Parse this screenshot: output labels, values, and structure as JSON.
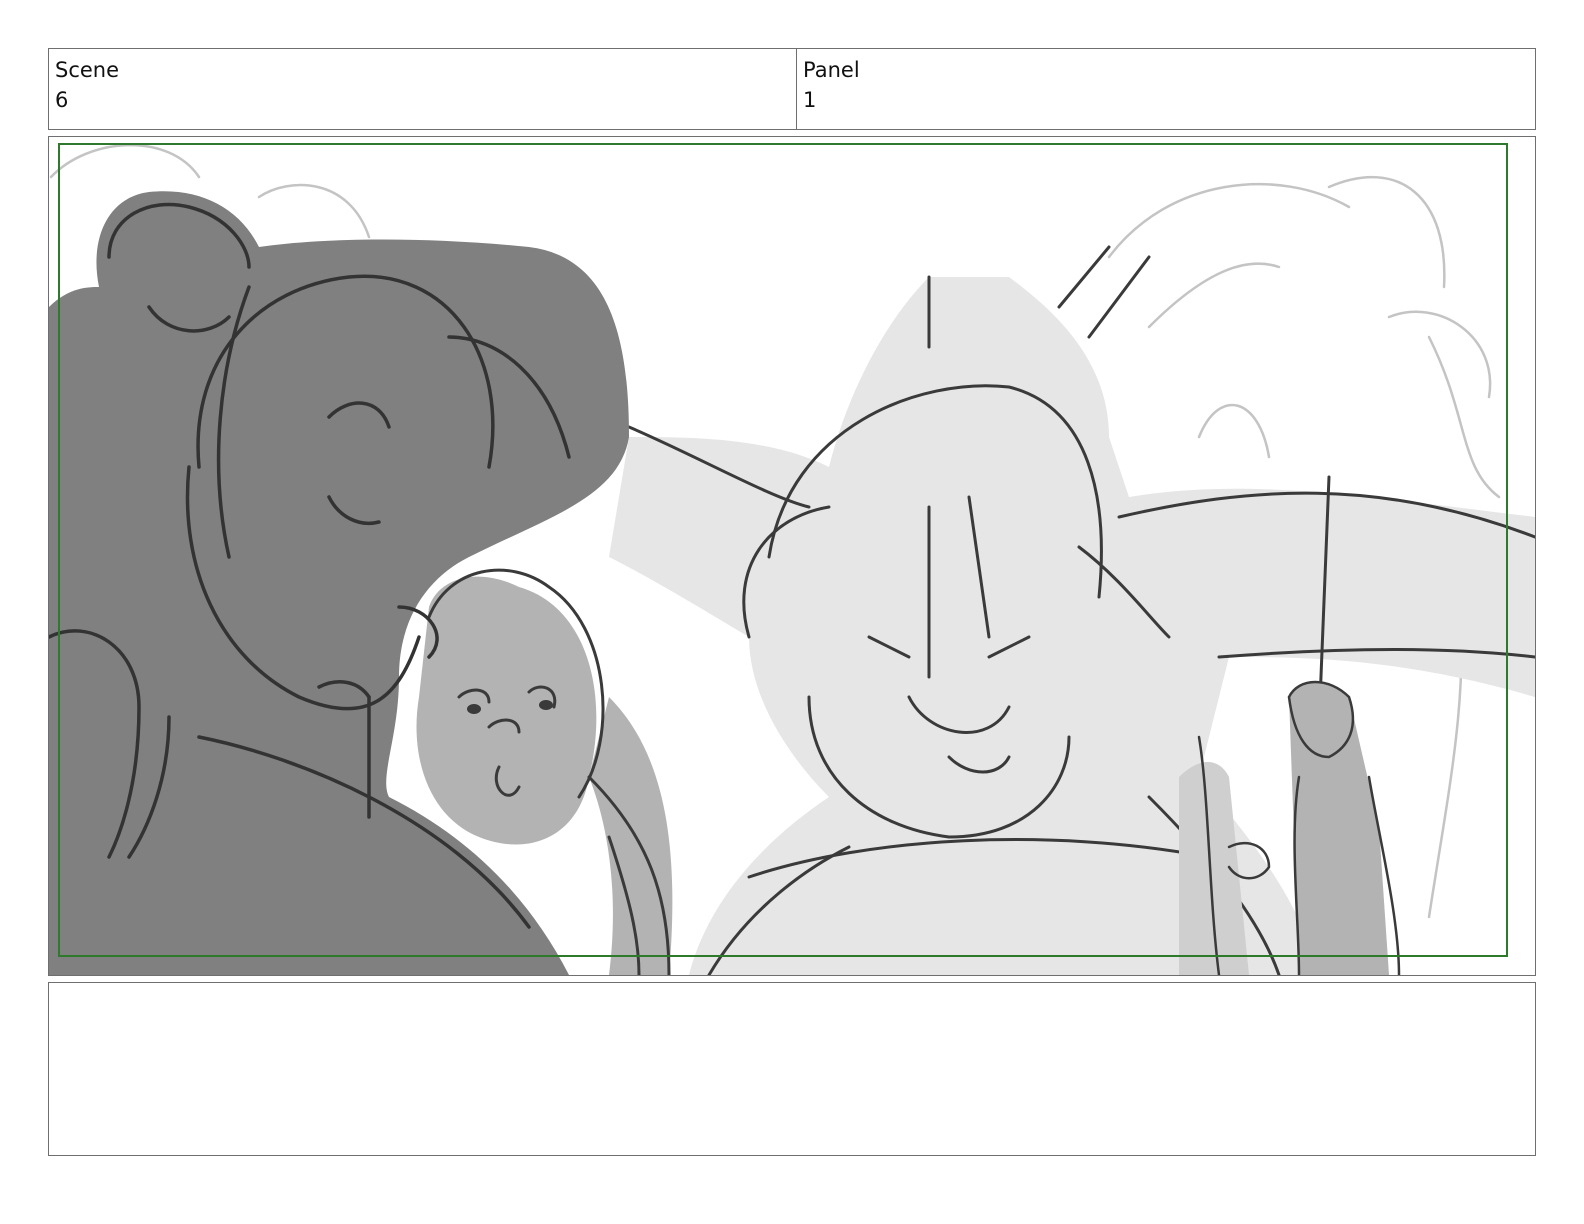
{
  "header": {
    "scene_label": "Scene",
    "scene_value": "6",
    "panel_label": "Panel",
    "panel_value": "1"
  },
  "artwork": {
    "icon": "storyboard-sketch-icon",
    "colors": {
      "frame_border": "#6f6f6f",
      "safe_area": "#2d7a2d",
      "dark_fill": "#808080",
      "mid_fill": "#b3b3b3",
      "light_fill": "#e6e6e6",
      "ink": "#3a3a3a",
      "faint_ink": "#bdbdbd"
    }
  },
  "notes": {
    "text": ""
  }
}
